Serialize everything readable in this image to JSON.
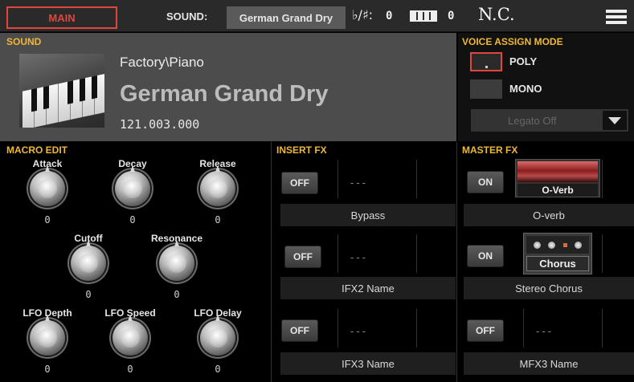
{
  "topbar": {
    "main_label": "MAIN",
    "sound_label": "SOUND:",
    "sound_name": "German Grand Dry",
    "transpose_label": "♭/♯:",
    "transpose_value": "0",
    "keyboard_value": "0",
    "chord": "N.C."
  },
  "sound": {
    "title": "SOUND",
    "bank": "Factory\\Piano",
    "name": "German Grand Dry",
    "number": "121.003.000"
  },
  "voice_assign": {
    "title": "VOICE ASSIGN MODE",
    "poly_label": "POLY",
    "mono_label": "MONO",
    "legato_label": "Legato Off",
    "selected": "POLY"
  },
  "macro": {
    "title": "MACRO EDIT",
    "knobs": [
      {
        "label": "Attack",
        "value": "0"
      },
      {
        "label": "Decay",
        "value": "0"
      },
      {
        "label": "Release",
        "value": "0"
      },
      {
        "label": "Cutoff",
        "value": "0"
      },
      {
        "label": "Resonance",
        "value": "0"
      },
      {
        "label": "LFO Depth",
        "value": "0"
      },
      {
        "label": "LFO Speed",
        "value": "0"
      },
      {
        "label": "LFO Delay",
        "value": "0"
      }
    ]
  },
  "insert_fx": {
    "title": "INSERT FX",
    "slots": [
      {
        "state": "OFF",
        "dash": "---",
        "name": "Bypass"
      },
      {
        "state": "OFF",
        "dash": "---",
        "name": "IFX2 Name"
      },
      {
        "state": "OFF",
        "dash": "---",
        "name": "IFX3 Name"
      }
    ]
  },
  "master_fx": {
    "title": "MASTER FX",
    "slots": [
      {
        "state": "ON",
        "thumb": "O-Verb",
        "name": "O-verb"
      },
      {
        "state": "ON",
        "thumb": "Chorus",
        "name": "Stereo Chorus"
      },
      {
        "state": "OFF",
        "dash": "---",
        "name": "MFX3 Name"
      }
    ]
  },
  "colors": {
    "accent_red": "#e0463e",
    "section_title": "#f0b832"
  }
}
